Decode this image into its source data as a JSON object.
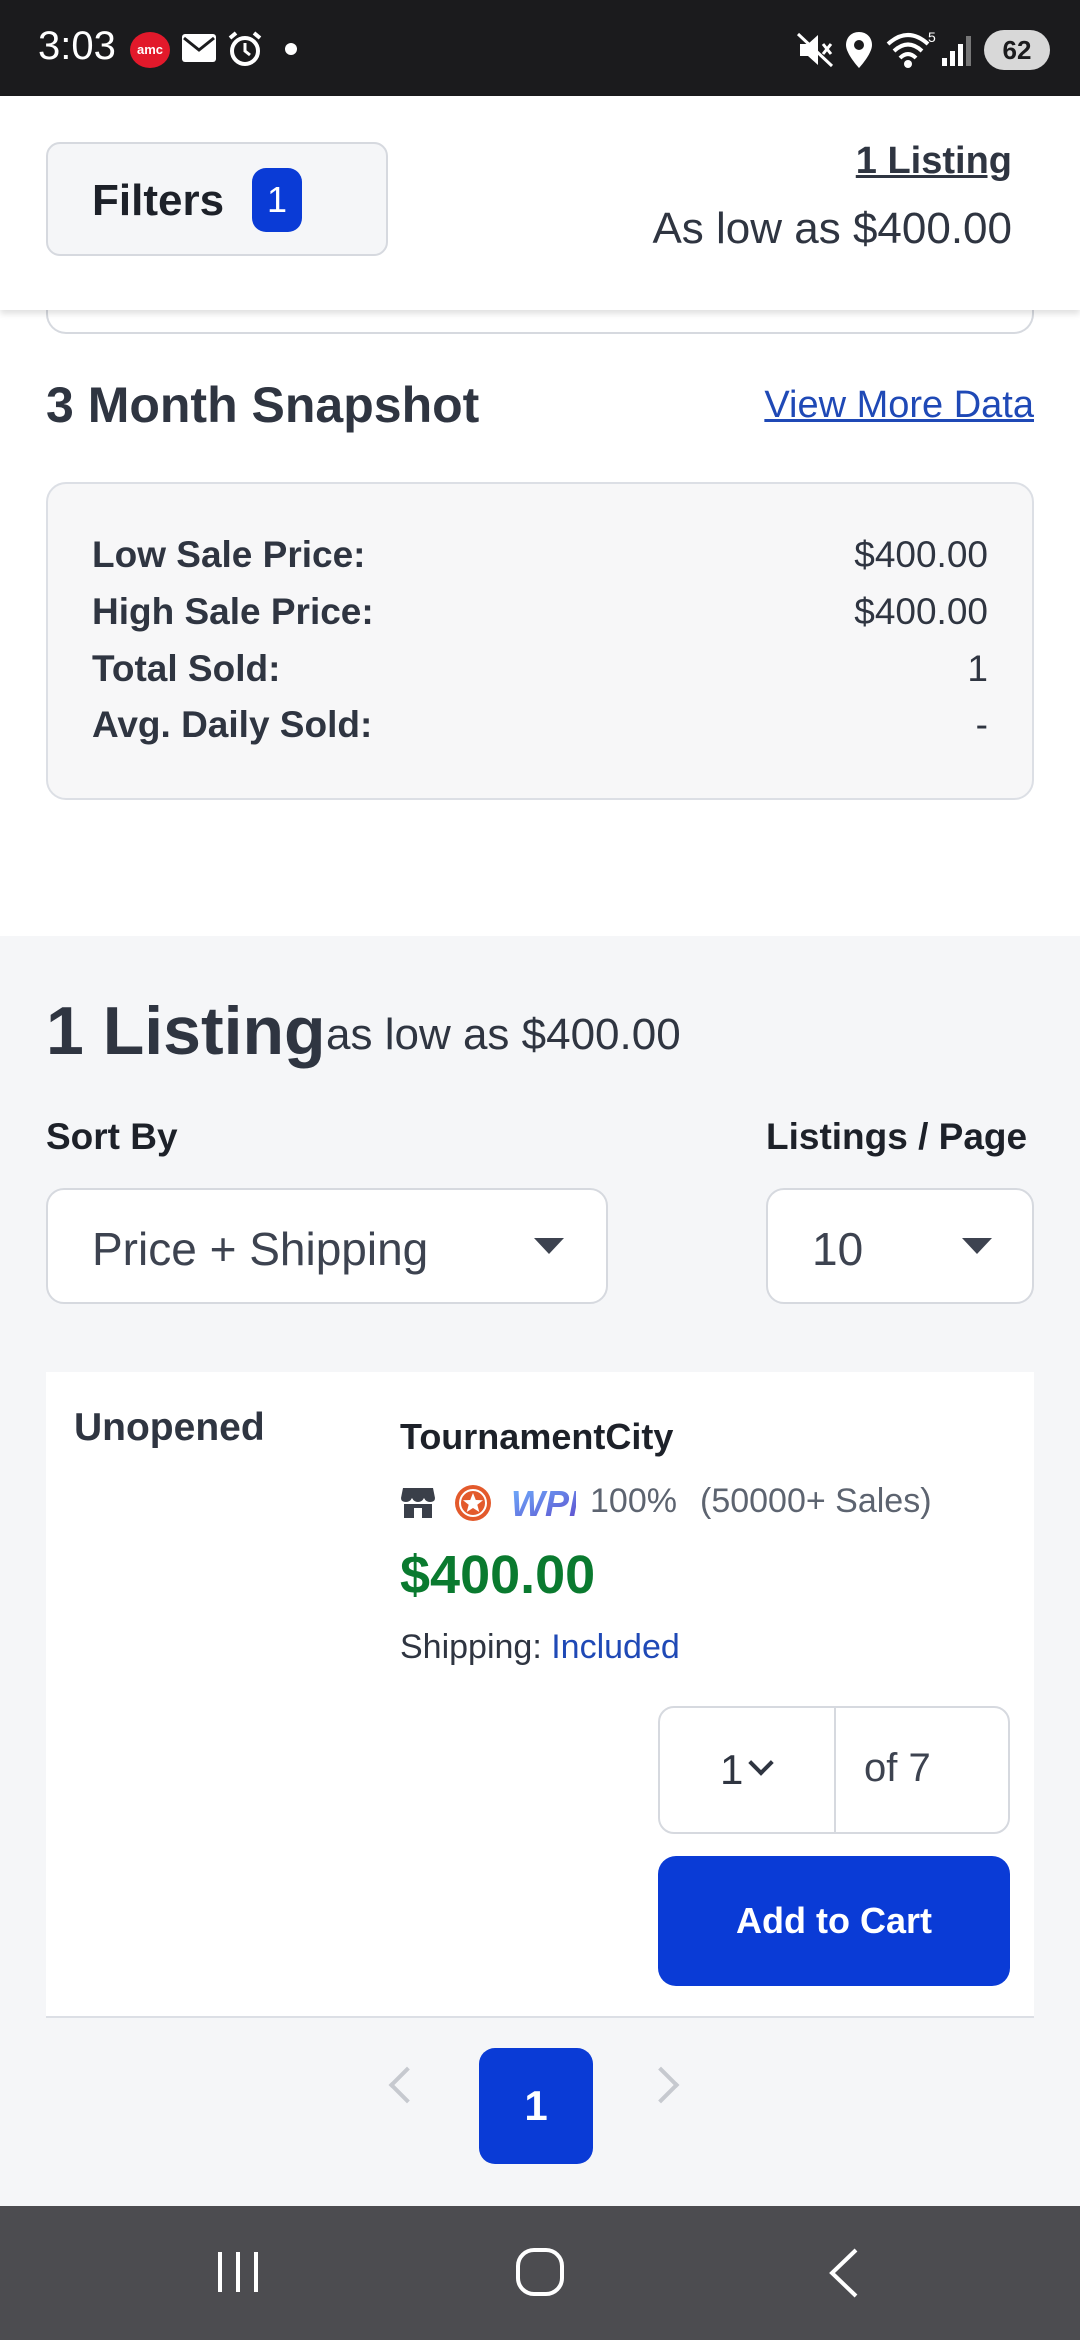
{
  "status_bar": {
    "time": "3:03",
    "amc_label": "amc",
    "battery": "62",
    "icons": [
      "amc-app-icon",
      "mail-icon",
      "alarm-icon",
      "dot-icon",
      "mute-icon",
      "location-icon",
      "wifi-icon",
      "signal-icon",
      "battery-icon"
    ]
  },
  "header": {
    "filters_label": "Filters",
    "filters_count": "1",
    "listing_link": "1 Listing",
    "low_price": "As low as $400.00"
  },
  "snapshot": {
    "title": "3 Month Snapshot",
    "view_more": "View More Data",
    "rows": [
      {
        "label": "Low Sale Price:",
        "value": "$400.00"
      },
      {
        "label": "High Sale Price:",
        "value": "$400.00"
      },
      {
        "label": "Total Sold:",
        "value": "1"
      },
      {
        "label": "Avg. Daily Sold:",
        "value": "-"
      }
    ]
  },
  "listings": {
    "count": "1 Listing",
    "low_text": "as low as $400.00",
    "sort_by_label": "Sort By",
    "sort_value": "Price + Shipping",
    "per_page_label": "Listings / Page",
    "per_page_value": "10"
  },
  "listing": {
    "condition": "Unopened",
    "seller": "TournamentCity",
    "badge_wpn": "WPN",
    "rating": "100%",
    "sales": "(50000+ Sales)",
    "price": "$400.00",
    "shipping_label": "Shipping:",
    "shipping_value": "Included",
    "quantity": "1",
    "quantity_of": "of 7",
    "add_to_cart": "Add to Cart"
  },
  "pagination": {
    "current": "1"
  },
  "colors": {
    "brand_blue": "#0a3bd6",
    "price_green": "#0a7a2f",
    "link_blue": "#1f49b6"
  }
}
